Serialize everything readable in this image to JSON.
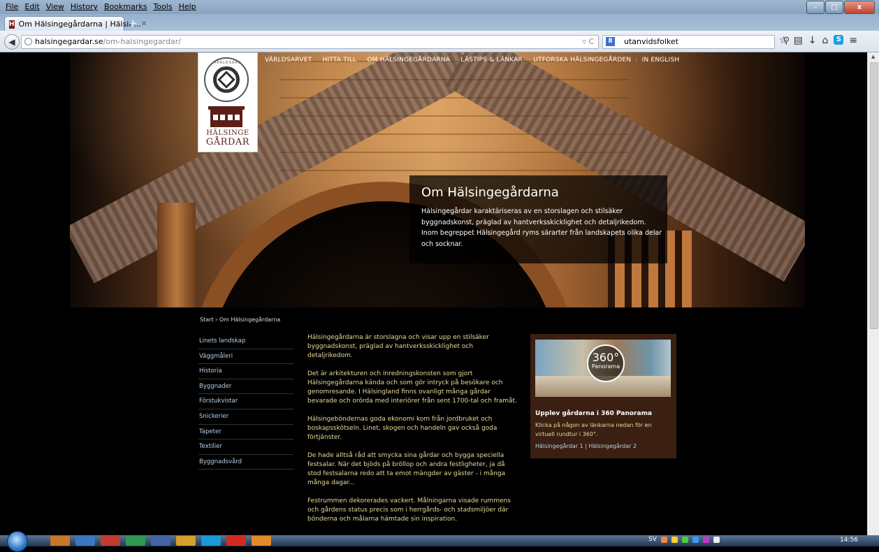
{
  "browser": {
    "menu": [
      "File",
      "Edit",
      "View",
      "History",
      "Bookmarks",
      "Tools",
      "Help"
    ],
    "tab_title": "Om Hälsingegårdarna | Hälsin...",
    "tab_favicon_letter": "H",
    "url_domain": "halsingegardar.se",
    "url_path": "/om-halsingegardar/",
    "search_text": "utanvidsfolket",
    "win_min": "–",
    "win_max": "□",
    "win_close": "x"
  },
  "site": {
    "logo": {
      "line1": "HÄLSINGE",
      "line2": "GÅRDAR",
      "seal_text": "VÄRLDSARV"
    },
    "nav": [
      "VÄRLDSARVET",
      "HITTA TILL",
      "OM HÄLSINGEGÅRDARNA",
      "LÄSTIPS & LÄNKAR",
      "UTFORSKA HÄLSINGEGÅRDEN",
      "IN ENGLISH"
    ],
    "intro": {
      "title": "Om Hälsingegårdarna",
      "text": "Hälsingegårdar karaktäriseras av en storslagen och stilsäker byggnadskonst, präglad av hantverksskicklighet och detaljrikedom. Inom begreppet Hälsingegård ryms särarter från landskapets olika delar och socknar."
    },
    "breadcrumb": "Start › Om Hälsingegårdarna",
    "sidenav": [
      "Linets landskap",
      "Väggmåleri",
      "Historia",
      "Byggnader",
      "Förstukvistar",
      "Snickerier",
      "Tapeter",
      "Textilier",
      "Byggnadsvård"
    ],
    "article": [
      "Hälsingegårdarna är storslagna och visar upp en stilsäker byggnadskonst, präglad av hantverksskicklighet och detaljrikedom.",
      "Det är arkitekturen och inredningskonsten som gjort Hälsingegårdarna kända och som gör intryck på besökare och genomresande. I Hälsingland finns ovanligt många gårdar bevarade och orörda med interiörer från sent 1700-tal och framåt.",
      "Hälsingeböndernas goda ekonomi kom från jordbruket och boskapsskötseln. Linet, skogen och handeln gav också goda förtjänster.",
      "De hade alltså råd att smycka sina gårdar och bygga speciella festsalar. När det bjöds på bröllop och andra festligheter, ja då stod festsalarna redo att ta emot mängder av gäster - i många många dagar...",
      "Festrummen dekorerades vackert. Målningarna visade rummens och gårdens status precis som i herrgårds- och stadsmiljöer där bönderna och målarna hämtade sin inspiration."
    ],
    "panel": {
      "badge_big": "360°",
      "badge_small": "Panorama",
      "title": "Upplev gårdarna i 360 Panorama",
      "text": "Klicka på någon av länkarna nedan för en virtuell rundtur i 360°.",
      "links": "Hälsingegårdar 1 | Hälsingegårdar 2"
    }
  },
  "taskbar": {
    "lang": "SV",
    "clock": "14:56"
  },
  "colors": {
    "accent_text": "#e6dc9a",
    "link_blue": "#b9d2e8",
    "panel_bg": "#3a1f12",
    "logo_brown": "#5b1f18"
  }
}
